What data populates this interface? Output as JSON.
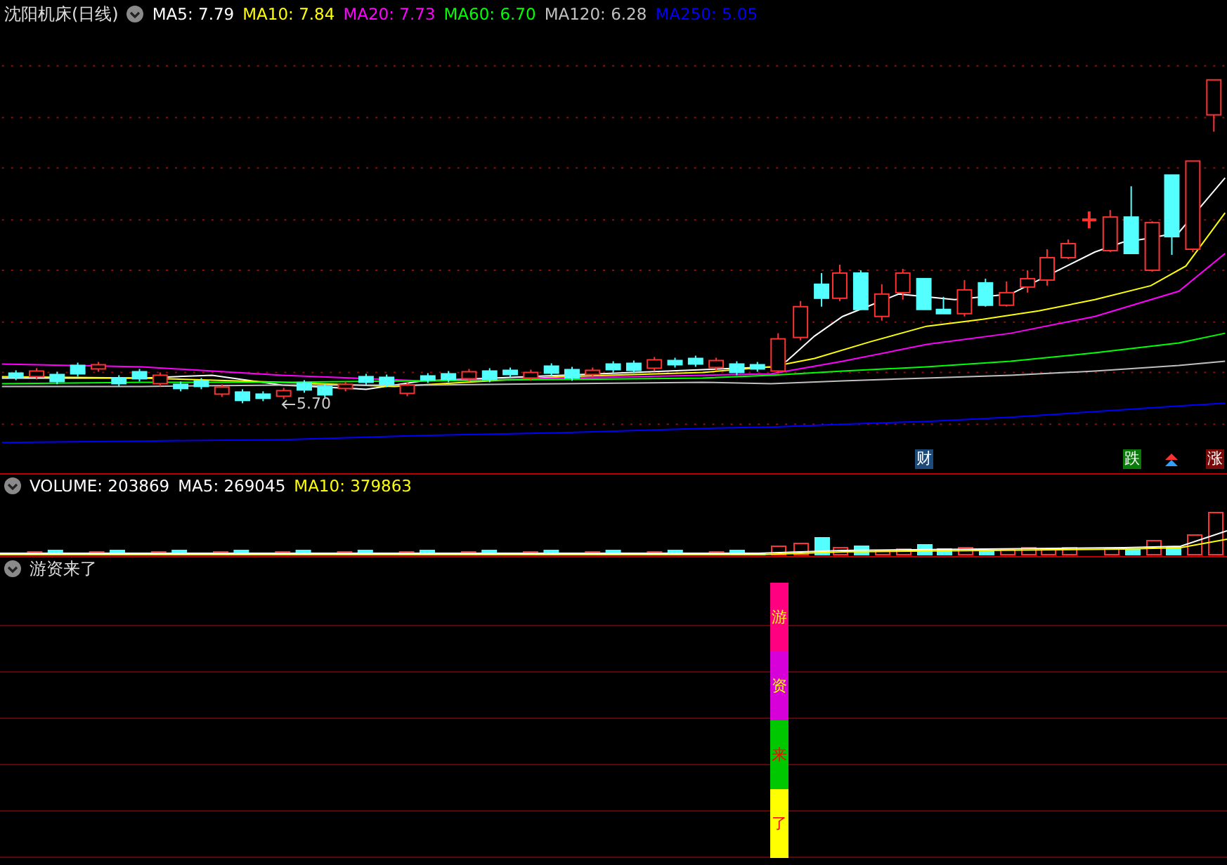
{
  "price_panel": {
    "title": "沈阳机床(日线)",
    "ma_legend": [
      {
        "label": "MA5: 7.79",
        "color": "#ffffff"
      },
      {
        "label": "MA10: 7.84",
        "color": "#ffff00"
      },
      {
        "label": "MA20: 7.73",
        "color": "#ff00ff"
      },
      {
        "label": "MA60: 6.70",
        "color": "#00ff00"
      },
      {
        "label": "MA120: 6.28",
        "color": "#c0c0c0"
      },
      {
        "label": "MA250: 5.05",
        "color": "#0000ff"
      }
    ],
    "low_marker": "5.70",
    "badges": [
      {
        "text": "财",
        "color": "#1c4a7a"
      },
      {
        "text": "跌",
        "color": "#0a7a0a"
      },
      {
        "text": "涨",
        "color": "#7a0a0a"
      }
    ]
  },
  "volume_panel": {
    "legend": [
      {
        "label": "VOLUME: 203869",
        "color": "#ffffff"
      },
      {
        "label": "MA5: 269045",
        "color": "#ffffff"
      },
      {
        "label": "MA10: 379863",
        "color": "#ffff00"
      }
    ]
  },
  "indicator_panel": {
    "title": "游资来了",
    "bar_segments": [
      {
        "text": "游",
        "color": "#ff0080"
      },
      {
        "text": "资",
        "color": "#d800d8"
      },
      {
        "text": "来",
        "color": "#00c800"
      },
      {
        "text": "了",
        "color": "#ffff00"
      }
    ]
  }
}
